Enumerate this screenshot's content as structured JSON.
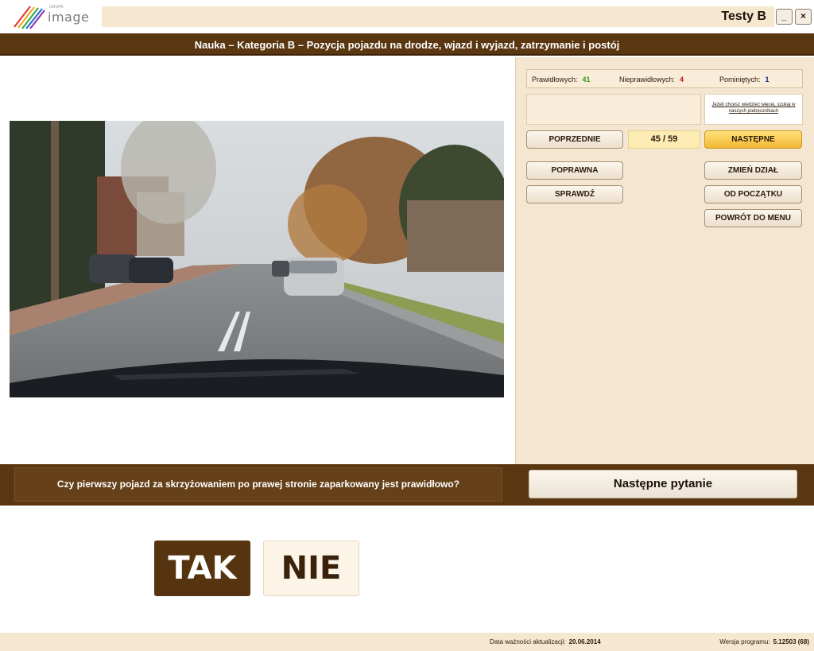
{
  "topbar": {
    "logo_text": "image",
    "logo_sup": "GRUPA",
    "app_title": "Testy B",
    "minimize_label": "_",
    "close_label": "×"
  },
  "header": {
    "title": "Nauka – Kategoria B – Pozycja pojazdu na drodze, wjazd i wyjazd, zatrzymanie i postój"
  },
  "stats": {
    "correct_label": "Prawidłowych:",
    "correct_value": "41",
    "wrong_label": "Nieprawidłowych:",
    "wrong_value": "4",
    "skipped_label": "Pominiętych:",
    "skipped_value": "1"
  },
  "help": {
    "text": "Jeżeli chcesz wiedzieć więcej, szukaj w naszych podręcznikach"
  },
  "nav": {
    "prev_label": "POPRZEDNIE",
    "counter": "45 / 59",
    "next_label": "NASTĘPNE",
    "correct_answer_label": "POPRAWNA",
    "check_label": "SPRAWDŹ",
    "change_section_label": "ZMIEŃ DZIAŁ",
    "from_start_label": "OD POCZĄTKU",
    "back_menu_label": "POWRÓT DO MENU"
  },
  "question": {
    "text": "Czy pierwszy pojazd za skrzyżowaniem po prawej stronie zaparkowany jest prawidłowo?",
    "next_question_label": "Następne pytanie"
  },
  "answers": {
    "yes_label": "TAK",
    "no_label": "NIE"
  },
  "footer": {
    "date_label": "Data ważności aktualizacji:",
    "date_value": "20.06.2014",
    "version_label": "Wersja programu:",
    "version_value": "5.12503 (68)"
  },
  "colors": {
    "brown_bar": "#5a3711",
    "panel_bg": "#f5e6d1",
    "accent_yellow": "#f2b733",
    "correct_green": "#2f9a2a",
    "wrong_red": "#b71a1a",
    "skipped_blue": "#1a2a8a"
  },
  "icons": {
    "logo": "image-logo-stripes",
    "minimize": "minimize-icon",
    "close": "close-icon"
  }
}
